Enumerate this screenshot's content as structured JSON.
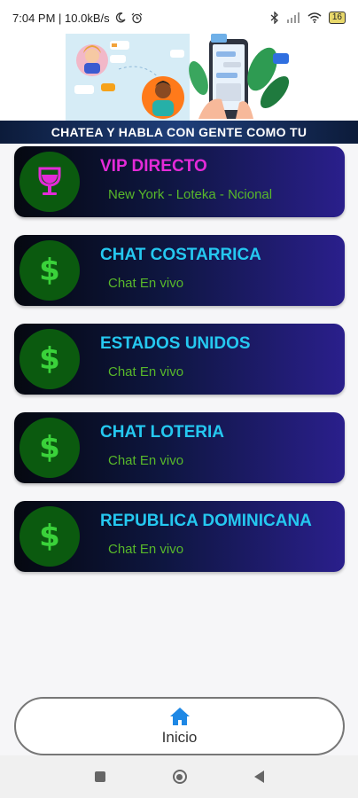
{
  "status_bar": {
    "time_and_speed": "7:04 PM | 10.0kB/s",
    "battery": "16"
  },
  "banner": {
    "caption": "CHATEA Y HABLA CON GENTE COMO TU"
  },
  "colors": {
    "accent_title": "#25c8f0",
    "vip_title": "#e42ad8",
    "subtitle": "#58b82a",
    "icon_bg": "#0b5a0f",
    "nav_icon": "#1e88e5"
  },
  "list": {
    "items": [
      {
        "title": "VIP DIRECTO",
        "subtitle": "New York - Loteka - Ncional",
        "icon": "wine-glass-icon"
      },
      {
        "title": "CHAT COSTARRICA",
        "subtitle": "Chat En vivo",
        "icon": "dollar-icon",
        "symbol": "$"
      },
      {
        "title": "ESTADOS UNIDOS",
        "subtitle": "Chat En vivo",
        "icon": "dollar-icon",
        "symbol": "$"
      },
      {
        "title": "CHAT LOTERIA",
        "subtitle": "Chat En vivo",
        "icon": "dollar-icon",
        "symbol": "$"
      },
      {
        "title": "REPUBLICA DOMINICANA",
        "subtitle": "Chat En vivo",
        "icon": "dollar-icon",
        "symbol": "$"
      }
    ]
  },
  "bottom_nav": {
    "label": "Inicio",
    "icon": "home-icon"
  }
}
